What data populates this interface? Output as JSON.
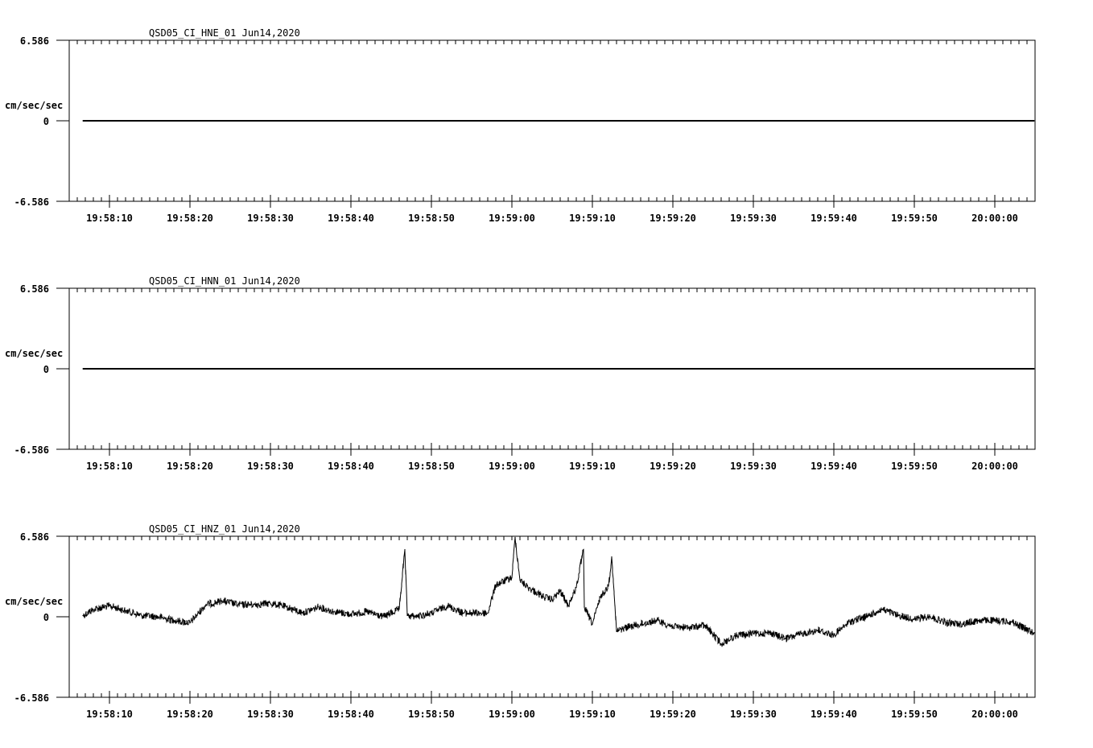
{
  "chart_data": [
    {
      "type": "line",
      "title": "QSD05_CI_HNE_01  Jun14,2020",
      "ylabel": "cm/sec/sec",
      "ylim": [
        -6.586,
        6.586
      ],
      "yticks": [
        "6.586",
        "0",
        "-6.586"
      ],
      "xticks": [
        "19:58:10",
        "19:58:20",
        "19:58:30",
        "19:58:40",
        "19:58:50",
        "19:59:00",
        "19:59:10",
        "19:59:20",
        "19:59:30",
        "19:59:40",
        "19:59:50",
        "20:00:00"
      ],
      "series": [
        {
          "x": [
            "19:58:06.7",
            "19:58:30",
            "19:58:50",
            "19:59:10",
            "19:59:30",
            "19:59:50",
            "20:00:04.9"
          ],
          "values": [
            0,
            0,
            0,
            0,
            0,
            0,
            0
          ]
        }
      ]
    },
    {
      "type": "line",
      "title": "QSD05_CI_HNN_01  Jun14,2020",
      "ylabel": "cm/sec/sec",
      "ylim": [
        -6.586,
        6.586
      ],
      "yticks": [
        "6.586",
        "0",
        "-6.586"
      ],
      "xticks": [
        "19:58:10",
        "19:58:20",
        "19:58:30",
        "19:58:40",
        "19:58:50",
        "19:59:00",
        "19:59:10",
        "19:59:20",
        "19:59:30",
        "19:59:40",
        "19:59:50",
        "20:00:00"
      ],
      "series": [
        {
          "x": [
            "19:58:06.7",
            "19:58:30",
            "19:58:50",
            "19:59:10",
            "19:59:30",
            "19:59:50",
            "20:00:04.9"
          ],
          "values": [
            0,
            0,
            0,
            0,
            0,
            0,
            0
          ]
        }
      ]
    },
    {
      "type": "line",
      "title": "QSD05_CI_HNZ_01  Jun14,2020",
      "ylabel": "cm/sec/sec",
      "ylim": [
        -6.586,
        6.586
      ],
      "yticks": [
        "6.586",
        "0",
        "-6.586"
      ],
      "xticks": [
        "19:58:10",
        "19:58:20",
        "19:58:30",
        "19:58:40",
        "19:58:50",
        "19:59:00",
        "19:59:10",
        "19:59:20",
        "19:59:30",
        "19:59:40",
        "19:59:50",
        "20:00:00"
      ],
      "series": [
        {
          "x": [
            "19:58:06.7",
            "19:58:08",
            "19:58:10",
            "19:58:12",
            "19:58:14",
            "19:58:16",
            "19:58:18",
            "19:58:20",
            "19:58:22",
            "19:58:24",
            "19:58:26",
            "19:58:28",
            "19:58:30",
            "19:58:32",
            "19:58:34",
            "19:58:36",
            "19:58:38",
            "19:58:40",
            "19:58:42",
            "19:58:44",
            "19:58:46",
            "19:58:46.7",
            "19:58:47",
            "19:58:48",
            "19:58:50",
            "19:58:52",
            "19:58:54",
            "19:58:56",
            "19:58:57",
            "19:58:58",
            "19:59:00",
            "19:59:00.4",
            "19:59:01",
            "19:59:02",
            "19:59:03",
            "19:59:04",
            "19:59:05",
            "19:59:06",
            "19:59:07",
            "19:59:08",
            "19:59:08.9",
            "19:59:09",
            "19:59:10",
            "19:59:11",
            "19:59:12",
            "19:59:12.4",
            "19:59:13",
            "19:59:14",
            "19:59:16",
            "19:59:18",
            "19:59:20",
            "19:59:22",
            "19:59:24",
            "19:59:26",
            "19:59:28",
            "19:59:30",
            "19:59:32",
            "19:59:34",
            "19:59:36",
            "19:59:38",
            "19:59:40",
            "19:59:42",
            "19:59:44",
            "19:59:46",
            "19:59:48",
            "19:59:50",
            "19:59:52",
            "19:59:54",
            "19:59:56",
            "19:59:58",
            "20:00:00",
            "20:00:02",
            "20:00:04.9"
          ],
          "values": [
            0.1,
            0.6,
            0.9,
            0.5,
            0.1,
            0.0,
            -0.3,
            -0.5,
            1.0,
            1.3,
            1.0,
            1.0,
            1.1,
            0.8,
            0.3,
            0.8,
            0.4,
            0.2,
            0.4,
            0.0,
            0.6,
            5.5,
            0.1,
            0.0,
            0.3,
            0.9,
            0.3,
            0.3,
            0.3,
            2.6,
            3.2,
            6.5,
            3.0,
            2.4,
            2.0,
            1.6,
            1.4,
            2.1,
            0.9,
            2.4,
            5.5,
            0.8,
            -0.6,
            1.6,
            2.5,
            4.9,
            -1.2,
            -0.9,
            -0.6,
            -0.3,
            -0.8,
            -0.9,
            -0.7,
            -2.2,
            -1.5,
            -1.4,
            -1.3,
            -1.8,
            -1.4,
            -1.1,
            -1.5,
            -0.4,
            0.0,
            0.6,
            0.1,
            -0.2,
            0.0,
            -0.5,
            -0.6,
            -0.3,
            -0.3,
            -0.4,
            -1.3
          ]
        }
      ]
    }
  ]
}
